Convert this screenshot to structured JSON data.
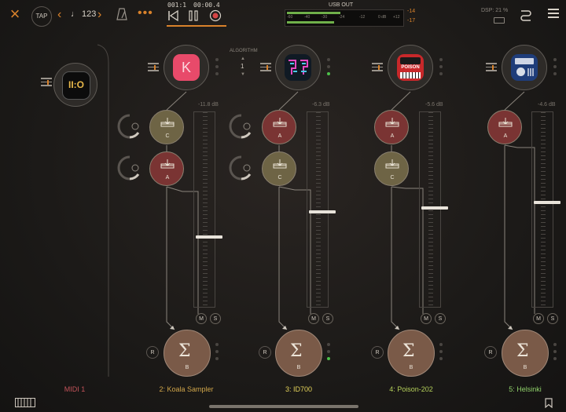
{
  "topbar": {
    "tap_label": "TAP",
    "tempo": "♩ 123",
    "position_bars": "001:1",
    "position_time": "00:00.4",
    "usb_label": "USB OUT",
    "meter_scale": [
      "-60",
      "-40",
      "-30",
      "-24",
      "-12",
      "0 dB",
      "+12"
    ],
    "peak_left": "-14",
    "peak_right": "-17",
    "dsp": "DSP: 21 %",
    "accent_color": "#d9822b"
  },
  "algorithm": {
    "label": "ALGORITHM",
    "value": "1"
  },
  "midi": {
    "name": "MIDI 1",
    "color": "#c4535a"
  },
  "channels": [
    {
      "name": "2: Koala Sampler",
      "color": "#d1a64a",
      "db": "-11.8 dB",
      "fx": [
        "C",
        "A"
      ],
      "bus": "B",
      "fader": 0.62
    },
    {
      "name": "3: ID700",
      "color": "#e4d35a",
      "db": "-6.3 dB",
      "fx": [
        "A",
        "C"
      ],
      "bus": "B",
      "fader": 0.72
    },
    {
      "name": "4: Poison-202",
      "color": "#b4cf5a",
      "db": "-5.6 dB",
      "fx": [
        "A",
        "C"
      ],
      "bus": "B",
      "fader": 0.74
    },
    {
      "name": "5: Helsinki",
      "color": "#8fd06a",
      "db": "-4.6 dB",
      "fx": [
        "A"
      ],
      "bus": "B",
      "fader": 0.77
    }
  ],
  "buttons": {
    "mute": "M",
    "solo": "S",
    "record": "R"
  },
  "apps": {
    "koala_letter": "K",
    "poison_text": "POISON"
  }
}
